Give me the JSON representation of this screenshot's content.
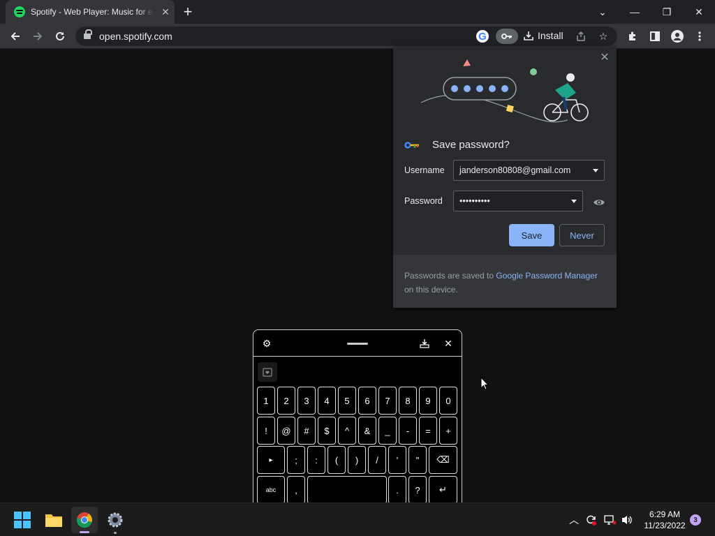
{
  "browser": {
    "tab_title": "Spotify - Web Player: Music for e",
    "tab_close": "✕",
    "new_tab": "+",
    "url": "open.spotify.com",
    "install_label": "Install",
    "window_controls": [
      "⌄",
      "—",
      "❐",
      "✕"
    ]
  },
  "password_bubble": {
    "title": "Save password?",
    "username_label": "Username",
    "username_value": "janderson80808@gmail.com",
    "password_label": "Password",
    "password_value": "••••••••••",
    "save_label": "Save",
    "never_label": "Never",
    "footer_prefix": "Passwords are saved to ",
    "footer_link": "Google Password Manager",
    "footer_suffix": " on this device.",
    "colors": {
      "accent": "#8ab4f8",
      "background": "#292a2d"
    }
  },
  "keyboard": {
    "row1": [
      "1",
      "2",
      "3",
      "4",
      "5",
      "6",
      "7",
      "8",
      "9",
      "0"
    ],
    "row2": [
      "!",
      "@",
      "#",
      "$",
      "^",
      "&",
      "_",
      "-",
      "=",
      "+"
    ],
    "row3": [
      "▸",
      ";",
      ":",
      "(",
      ")",
      "/",
      "'",
      "\"",
      "⌫"
    ],
    "row4": [
      "abc",
      ",",
      "",
      ".",
      "?",
      "↵"
    ]
  },
  "taskbar": {
    "time": "6:29 AM",
    "date": "11/23/2022",
    "notification_count": "3",
    "apps": [
      "windows-start",
      "file-explorer",
      "chrome",
      "settings"
    ]
  }
}
